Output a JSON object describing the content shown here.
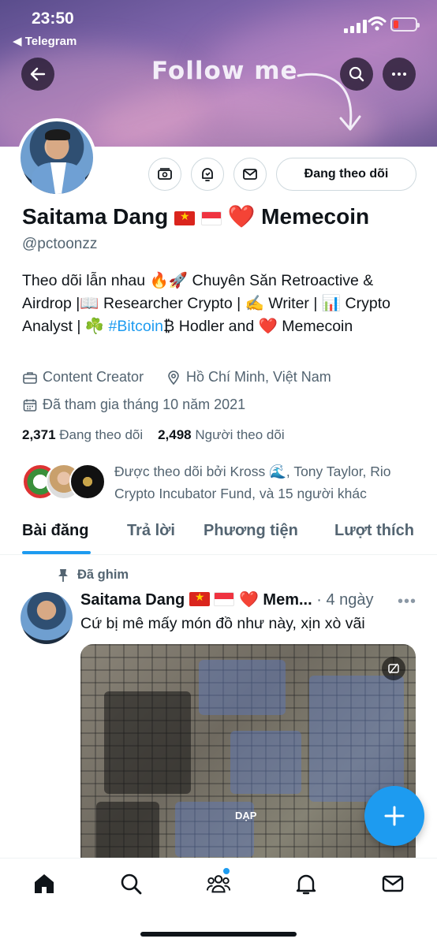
{
  "status_bar": {
    "time": "23:50",
    "back_app": "◀ Telegram"
  },
  "banner": {
    "text": "Follow me"
  },
  "profile": {
    "name": "Saitama Dang",
    "name_suffix": "Memecoin",
    "handle": "@pctoonzz",
    "following_button": "Đang theo dõi",
    "bio": {
      "part1": "Theo dõi lẫn nhau 🔥🚀 Chuyên Săn Retroactive & Airdrop |📖 Researcher Crypto | ✍️ Writer | 📊 Crypto Analyst | ☘️ ",
      "hashtag": "#Bitcoin",
      "part2": "₿ Hodler and ❤️ Memecoin"
    },
    "category": "Content Creator",
    "location": "Hồ Chí Minh, Việt Nam",
    "joined": "Đã tham gia tháng 10 năm 2021",
    "following_count": "2,371",
    "following_label": "Đang theo dõi",
    "followers_count": "2,498",
    "followers_label": "Người theo dõi",
    "followed_by": "Được theo dõi bởi Kross 🌊, Tony Taylor, Rio Crypto Incubator Fund, và 15 người khác"
  },
  "tabs": [
    {
      "label": "Bài đăng",
      "active": true
    },
    {
      "label": "Trả lời"
    },
    {
      "label": "Phương tiện"
    },
    {
      "label": "Lượt thích"
    }
  ],
  "pinned_post": {
    "pinned_label": "Đã ghim",
    "author": "Saitama Dang",
    "author_suffix": "Mem...",
    "time": "· 4 ngày",
    "text": "Cứ bị mê mấy món đồ như này, xịn xò vãi",
    "media_label": "DẠP"
  },
  "colors": {
    "accent": "#1d9bf0",
    "text": "#0f1419",
    "muted": "#536471"
  },
  "icons": [
    "back-arrow-icon",
    "search-icon",
    "more-icon",
    "tip-jar-icon",
    "notification-bell-icon",
    "mail-icon",
    "briefcase-icon",
    "location-pin-icon",
    "calendar-icon",
    "pin-icon",
    "compose-plus-icon",
    "home-icon",
    "explore-icon",
    "communities-icon",
    "mail-tab-icon"
  ]
}
